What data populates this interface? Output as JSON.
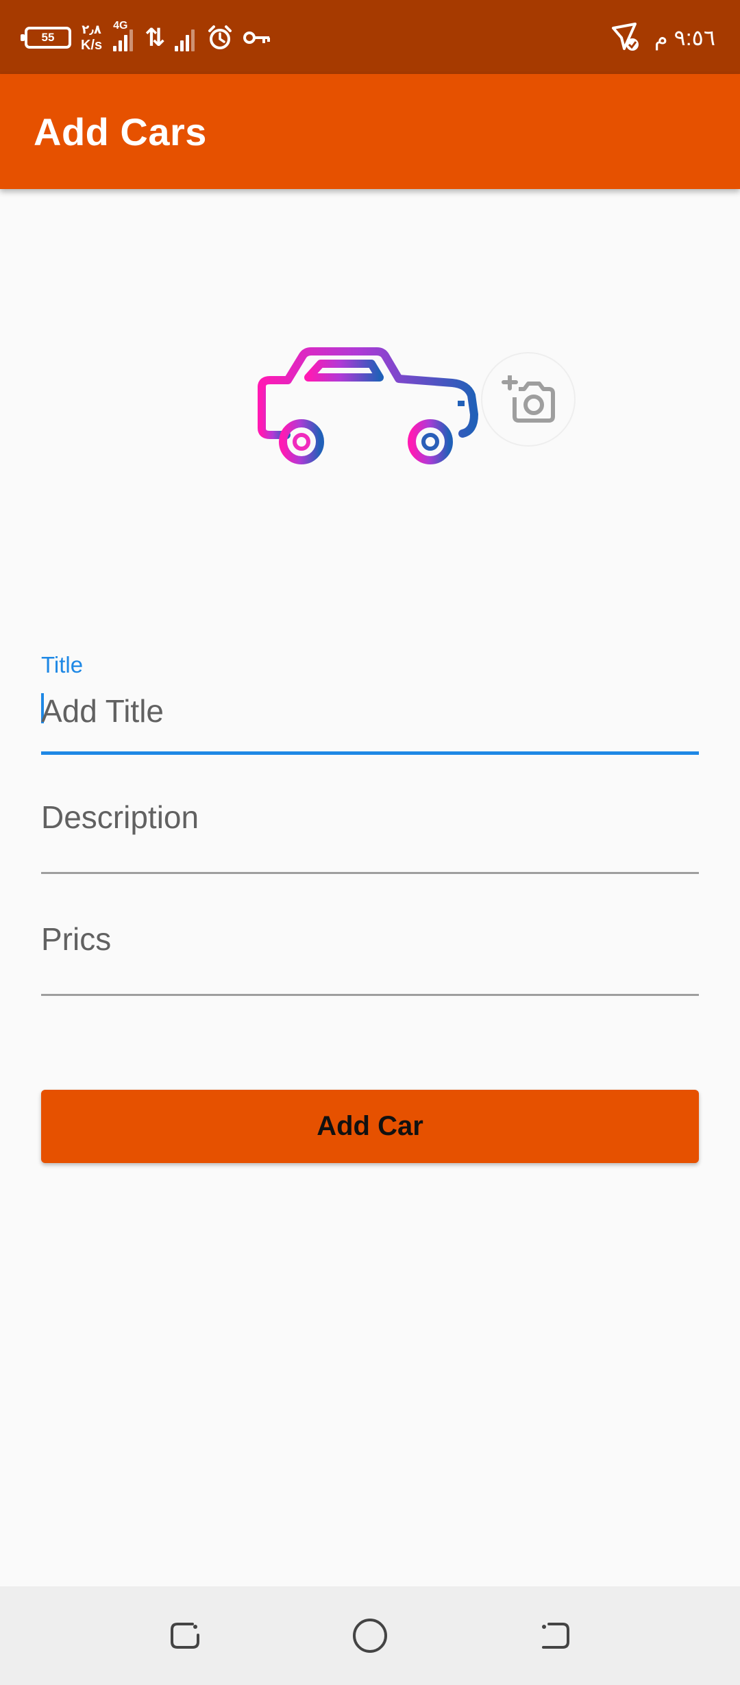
{
  "status_bar": {
    "battery": "55",
    "net_speed_value": "٢٫٨",
    "net_speed_unit": "K/s",
    "network_type": "4G",
    "data_arrows": "⇅",
    "time": "٩:٥٦ م"
  },
  "app_bar": {
    "title": "Add Cars"
  },
  "form": {
    "title_label": "Title",
    "title_placeholder": "Add Title",
    "description_placeholder": "Description",
    "price_placeholder": "Prics",
    "submit_label": "Add Car"
  },
  "icons": {
    "car": "car-icon",
    "camera": "add-photo-icon",
    "recents": "recents-icon",
    "home": "home-icon",
    "back": "back-icon"
  },
  "colors": {
    "status_bar": "#a63a00",
    "primary": "#e65100",
    "accent": "#1e88e5",
    "background": "#fafafa",
    "nav_bar": "#eeeeee"
  }
}
